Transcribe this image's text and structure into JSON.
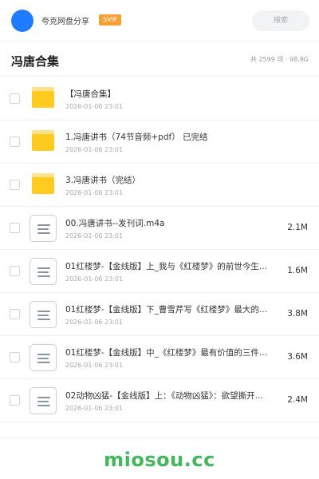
{
  "header": {
    "site_name": "夸克网盘分享",
    "badge": "SVIP",
    "search_placeholder": "搜索"
  },
  "title_bar": {
    "title": "冯唐合集",
    "summary": "共 2599 项 · 98.9G"
  },
  "items": [
    {
      "type": "folder",
      "name": "【冯唐合集】",
      "date": "2026-01-06 23:01",
      "size": ""
    },
    {
      "type": "folder",
      "name": "1.冯唐讲书（74节音频+pdf） 已完结",
      "date": "2026-01-06 23:01",
      "size": ""
    },
    {
      "type": "folder",
      "name": "3.冯唐讲书（完结）",
      "date": "2026-01-06 23:01",
      "size": ""
    },
    {
      "type": "file",
      "name": "00.冯唐讲书--发刊词.m4a",
      "date": "2026-01-06 23:01",
      "size": "2.1M"
    },
    {
      "type": "file",
      "name": "01红楼梦-【金线版】上_我与《红楼梦》的前世今生...",
      "date": "2026-01-06 23:01",
      "size": "1.6M"
    },
    {
      "type": "file",
      "name": "01红楼梦-【金线版】下_曹雪芹写《红楼梦》最大的...",
      "date": "2026-01-06 23:01",
      "size": "3.8M"
    },
    {
      "type": "file",
      "name": "01红楼梦-【金线版】中_《红楼梦》最有价值的三件...",
      "date": "2026-01-06 23:01",
      "size": "3.6M"
    },
    {
      "type": "file",
      "name": "02动物凶猛-【金线版】上：《动物凶猛》：欲望撕开...",
      "date": "2026-01-06 23:01",
      "size": "2.4M"
    }
  ],
  "watermark": "miosou.cc",
  "colors": {
    "avatar": "#1f7bff",
    "svip_badge": "#f7a035",
    "folder": "#ffcb21",
    "watermark": "#41b95a"
  }
}
